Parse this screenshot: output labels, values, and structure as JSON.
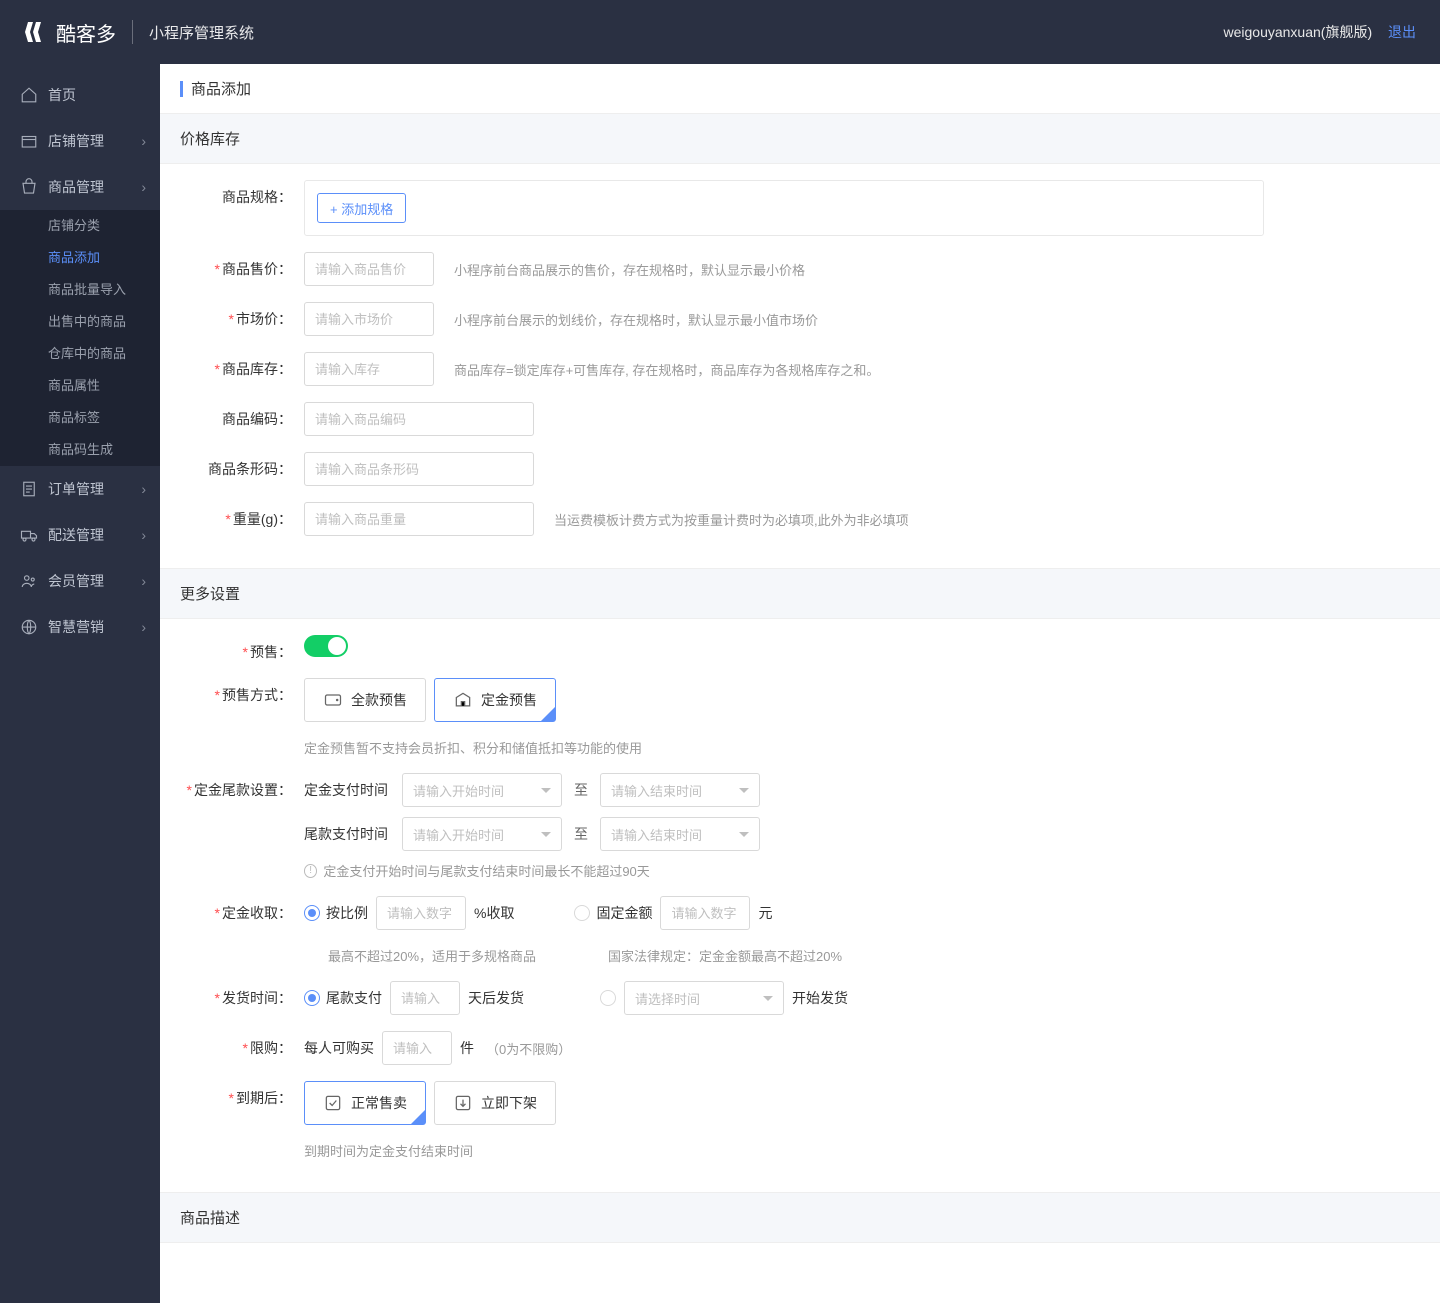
{
  "header": {
    "brand": "酷客多",
    "system_name": "小程序管理系统",
    "user": "weigouyanxuan(旗舰版)",
    "logout": "退出"
  },
  "sidebar": {
    "items": [
      {
        "label": "首页",
        "icon": "home"
      },
      {
        "label": "店铺管理",
        "icon": "shop",
        "expandable": true
      },
      {
        "label": "商品管理",
        "icon": "goods",
        "expandable": true,
        "subs": [
          {
            "label": "店铺分类"
          },
          {
            "label": "商品添加",
            "active": true
          },
          {
            "label": "商品批量导入"
          },
          {
            "label": "出售中的商品"
          },
          {
            "label": "仓库中的商品"
          },
          {
            "label": "商品属性"
          },
          {
            "label": "商品标签"
          },
          {
            "label": "商品码生成"
          }
        ]
      },
      {
        "label": "订单管理",
        "icon": "order",
        "expandable": true
      },
      {
        "label": "配送管理",
        "icon": "delivery",
        "expandable": true
      },
      {
        "label": "会员管理",
        "icon": "member",
        "expandable": true
      },
      {
        "label": "智慧营销",
        "icon": "marketing",
        "expandable": true
      }
    ]
  },
  "page": {
    "title": "商品添加",
    "section_price": "价格库存",
    "section_more": "更多设置",
    "section_desc": "商品描述"
  },
  "form": {
    "spec_label": "商品规格：",
    "add_spec_btn": "+ 添加规格",
    "sale_price_label": "商品售价：",
    "sale_price_ph": "请输入商品售价",
    "sale_price_hint": "小程序前台商品展示的售价，存在规格时，默认显示最小价格",
    "market_price_label": "市场价：",
    "market_price_ph": "请输入市场价",
    "market_price_hint": "小程序前台展示的划线价，存在规格时，默认显示最小值市场价",
    "stock_label": "商品库存：",
    "stock_ph": "请输入库存",
    "stock_hint": "商品库存=锁定库存+可售库存, 存在规格时，商品库存为各规格库存之和。",
    "code_label": "商品编码：",
    "code_ph": "请输入商品编码",
    "barcode_label": "商品条形码：",
    "barcode_ph": "请输入商品条形码",
    "weight_label": "重量(g)：",
    "weight_ph": "请输入商品重量",
    "weight_hint": "当运费模板计费方式为按重量计费时为必填项,此外为非必填项",
    "presale_label": "预售：",
    "presale_mode_label": "预售方式：",
    "presale_mode_full": "全款预售",
    "presale_mode_deposit": "定金预售",
    "presale_mode_hint": "定金预售暂不支持会员折扣、积分和储值抵扣等功能的使用",
    "tail_label": "定金尾款设置：",
    "deposit_pay_time": "定金支付时间",
    "tail_pay_time": "尾款支付时间",
    "time_start_ph": "请输入开始时间",
    "time_end_ph": "请输入结束时间",
    "to": "至",
    "tail_hint": "定金支付开始时间与尾款支付结束时间最长不能超过90天",
    "deposit_collect_label": "定金收取：",
    "by_ratio": "按比例",
    "ratio_ph": "请输入数字",
    "ratio_suffix": "%收取",
    "by_fixed": "固定金额",
    "fixed_ph": "请输入数字",
    "fixed_suffix": "元",
    "ratio_hint": "最高不超过20%，适用于多规格商品",
    "fixed_hint": "国家法律规定：定金金额最高不超过20%",
    "ship_time_label": "发货时间：",
    "after_tail_pay": "尾款支付",
    "days_ph": "请输入",
    "days_suffix": "天后发货",
    "select_time_ph": "请选择时间",
    "start_ship": "开始发货",
    "limit_buy_label": "限购：",
    "limit_prefix": "每人可购买",
    "limit_ph": "请输入",
    "limit_suffix": "件",
    "limit_hint": "（0为不限购）",
    "expire_label": "到期后：",
    "expire_normal": "正常售卖",
    "expire_off": "立即下架",
    "expire_hint": "到期时间为定金支付结束时间"
  }
}
